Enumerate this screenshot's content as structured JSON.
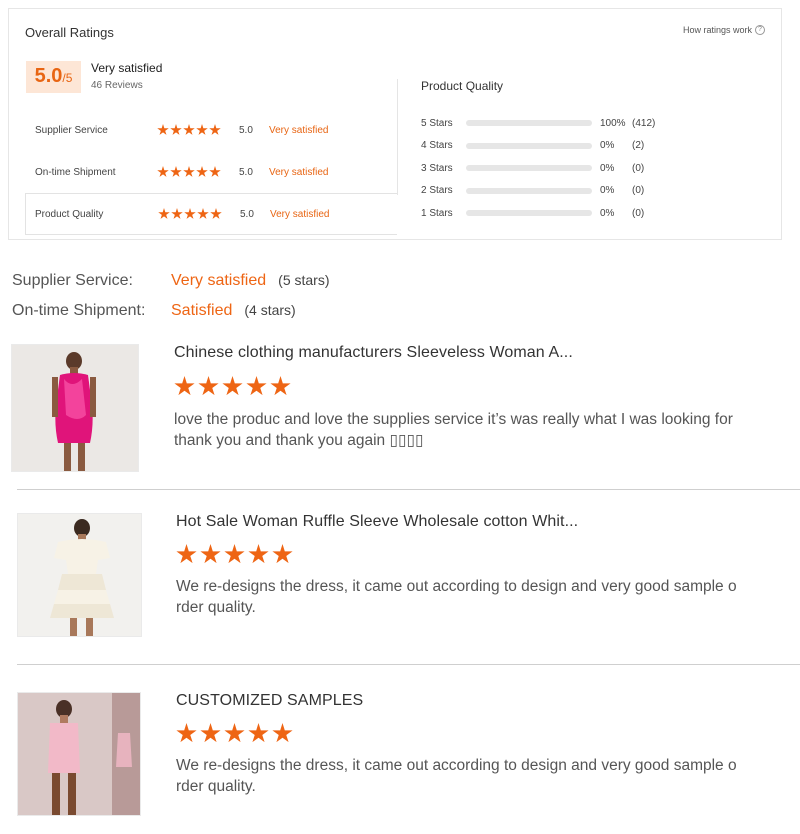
{
  "card": {
    "title": "Overall Ratings",
    "how_link": "How ratings work",
    "help_icon": "?",
    "score": "5.0",
    "score_max": "/5",
    "overall_label": "Very satisfied",
    "reviews_count": "46 Reviews"
  },
  "ratings": [
    {
      "label": "Supplier Service",
      "score": "5.0",
      "text": "Very satisfied",
      "stars": 5
    },
    {
      "label": "On-time Shipment",
      "score": "5.0",
      "text": "Very satisfied",
      "stars": 5
    },
    {
      "label": "Product Quality",
      "score": "5.0",
      "text": "Very satisfied",
      "stars": 5
    }
  ],
  "distribution": {
    "title": "Product Quality",
    "rows": [
      {
        "label": "5 Stars",
        "fill": 1.0,
        "pct": "100%",
        "count": "(412)"
      },
      {
        "label": "4 Stars",
        "fill": 0.0,
        "pct": "0%",
        "count": "(2)"
      },
      {
        "label": "3 Stars",
        "fill": 0.0,
        "pct": "0%",
        "count": "(0)"
      },
      {
        "label": "2 Stars",
        "fill": 0.0,
        "pct": "0%",
        "count": "(0)"
      },
      {
        "label": "1 Stars",
        "fill": 0.0,
        "pct": "0%",
        "count": "(0)"
      }
    ]
  },
  "summary": [
    {
      "label": "Supplier Service:",
      "value": "Very satisfied",
      "stars": "(5 stars)"
    },
    {
      "label": "On-time Shipment:",
      "value": "Satisfied",
      "stars": "(4 stars)"
    }
  ],
  "reviews": [
    {
      "title": "Chinese clothing manufacturers Sleeveless Woman A...",
      "rating": 5,
      "text_line1": "love the produc and love the supplies service it’s was really what I was looking for",
      "text_line2": "thank you and thank you again ▯▯▯▯"
    },
    {
      "title": "Hot Sale Woman Ruffle Sleeve Wholesale cotton Whit...",
      "rating": 5,
      "text_line1": "We re-designs the dress, it came out according to design and very good sample o",
      "text_line2": "rder quality."
    },
    {
      "title": "CUSTOMIZED SAMPLES",
      "rating": 5,
      "text_line1": "We re-designs the dress, it came out according to design and very good sample o",
      "text_line2": "rder quality."
    }
  ],
  "colors": {
    "accent": "#ee6514",
    "badge_bg": "#fde6d6",
    "track": "#e6e6e6"
  },
  "icons": {
    "star": "star-icon",
    "help": "help-circle-icon"
  }
}
